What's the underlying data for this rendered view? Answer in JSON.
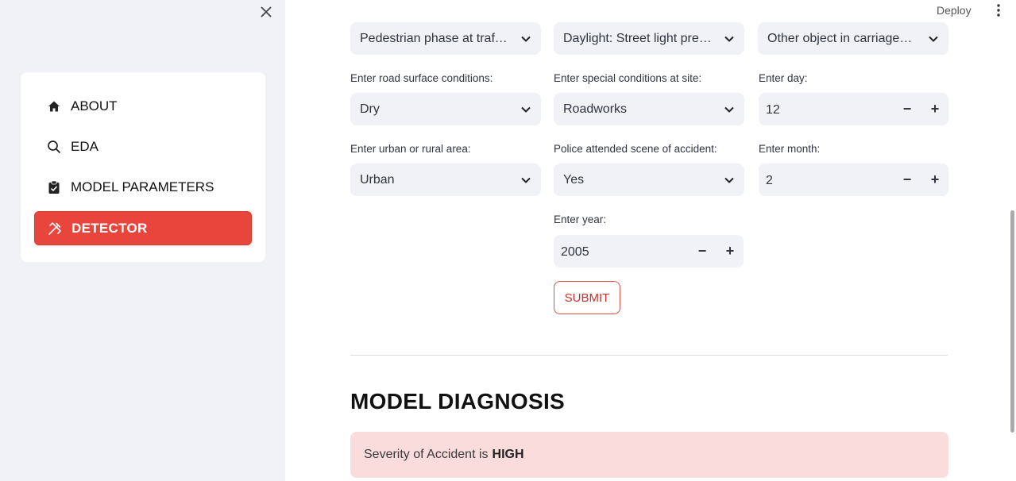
{
  "header": {
    "deploy_label": "Deploy"
  },
  "sidebar": {
    "items": [
      {
        "label": "ABOUT",
        "icon": "home-icon"
      },
      {
        "label": "EDA",
        "icon": "search-icon"
      },
      {
        "label": "MODEL PARAMETERS",
        "icon": "clipboard-icon"
      },
      {
        "label": "DETECTOR",
        "icon": "tools-icon",
        "active": true
      }
    ]
  },
  "form": {
    "top_selects": [
      "Pedestrian phase at traffic signal junction",
      "Daylight: Street light present",
      "Other object in carriageway"
    ],
    "road_surface": {
      "label": "Enter road surface conditions:",
      "value": "Dry"
    },
    "special_conditions": {
      "label": "Enter special conditions at site:",
      "value": "Roadworks"
    },
    "day": {
      "label": "Enter day:",
      "value": "12"
    },
    "area": {
      "label": "Enter urban or rural area:",
      "value": "Urban"
    },
    "police": {
      "label": "Police attended scene of accident:",
      "value": "Yes"
    },
    "month": {
      "label": "Enter month:",
      "value": "2"
    },
    "year": {
      "label": "Enter year:",
      "value": "2005"
    },
    "submit_label": "SUBMIT"
  },
  "diagnosis": {
    "title": "MODEL DIAGNOSIS",
    "text": "Severity of Accident is",
    "severity": "HIGH"
  },
  "colors": {
    "accent": "#e8453c",
    "result_bg": "#fadcdc",
    "sidebar_bg": "#f0f2f6"
  }
}
